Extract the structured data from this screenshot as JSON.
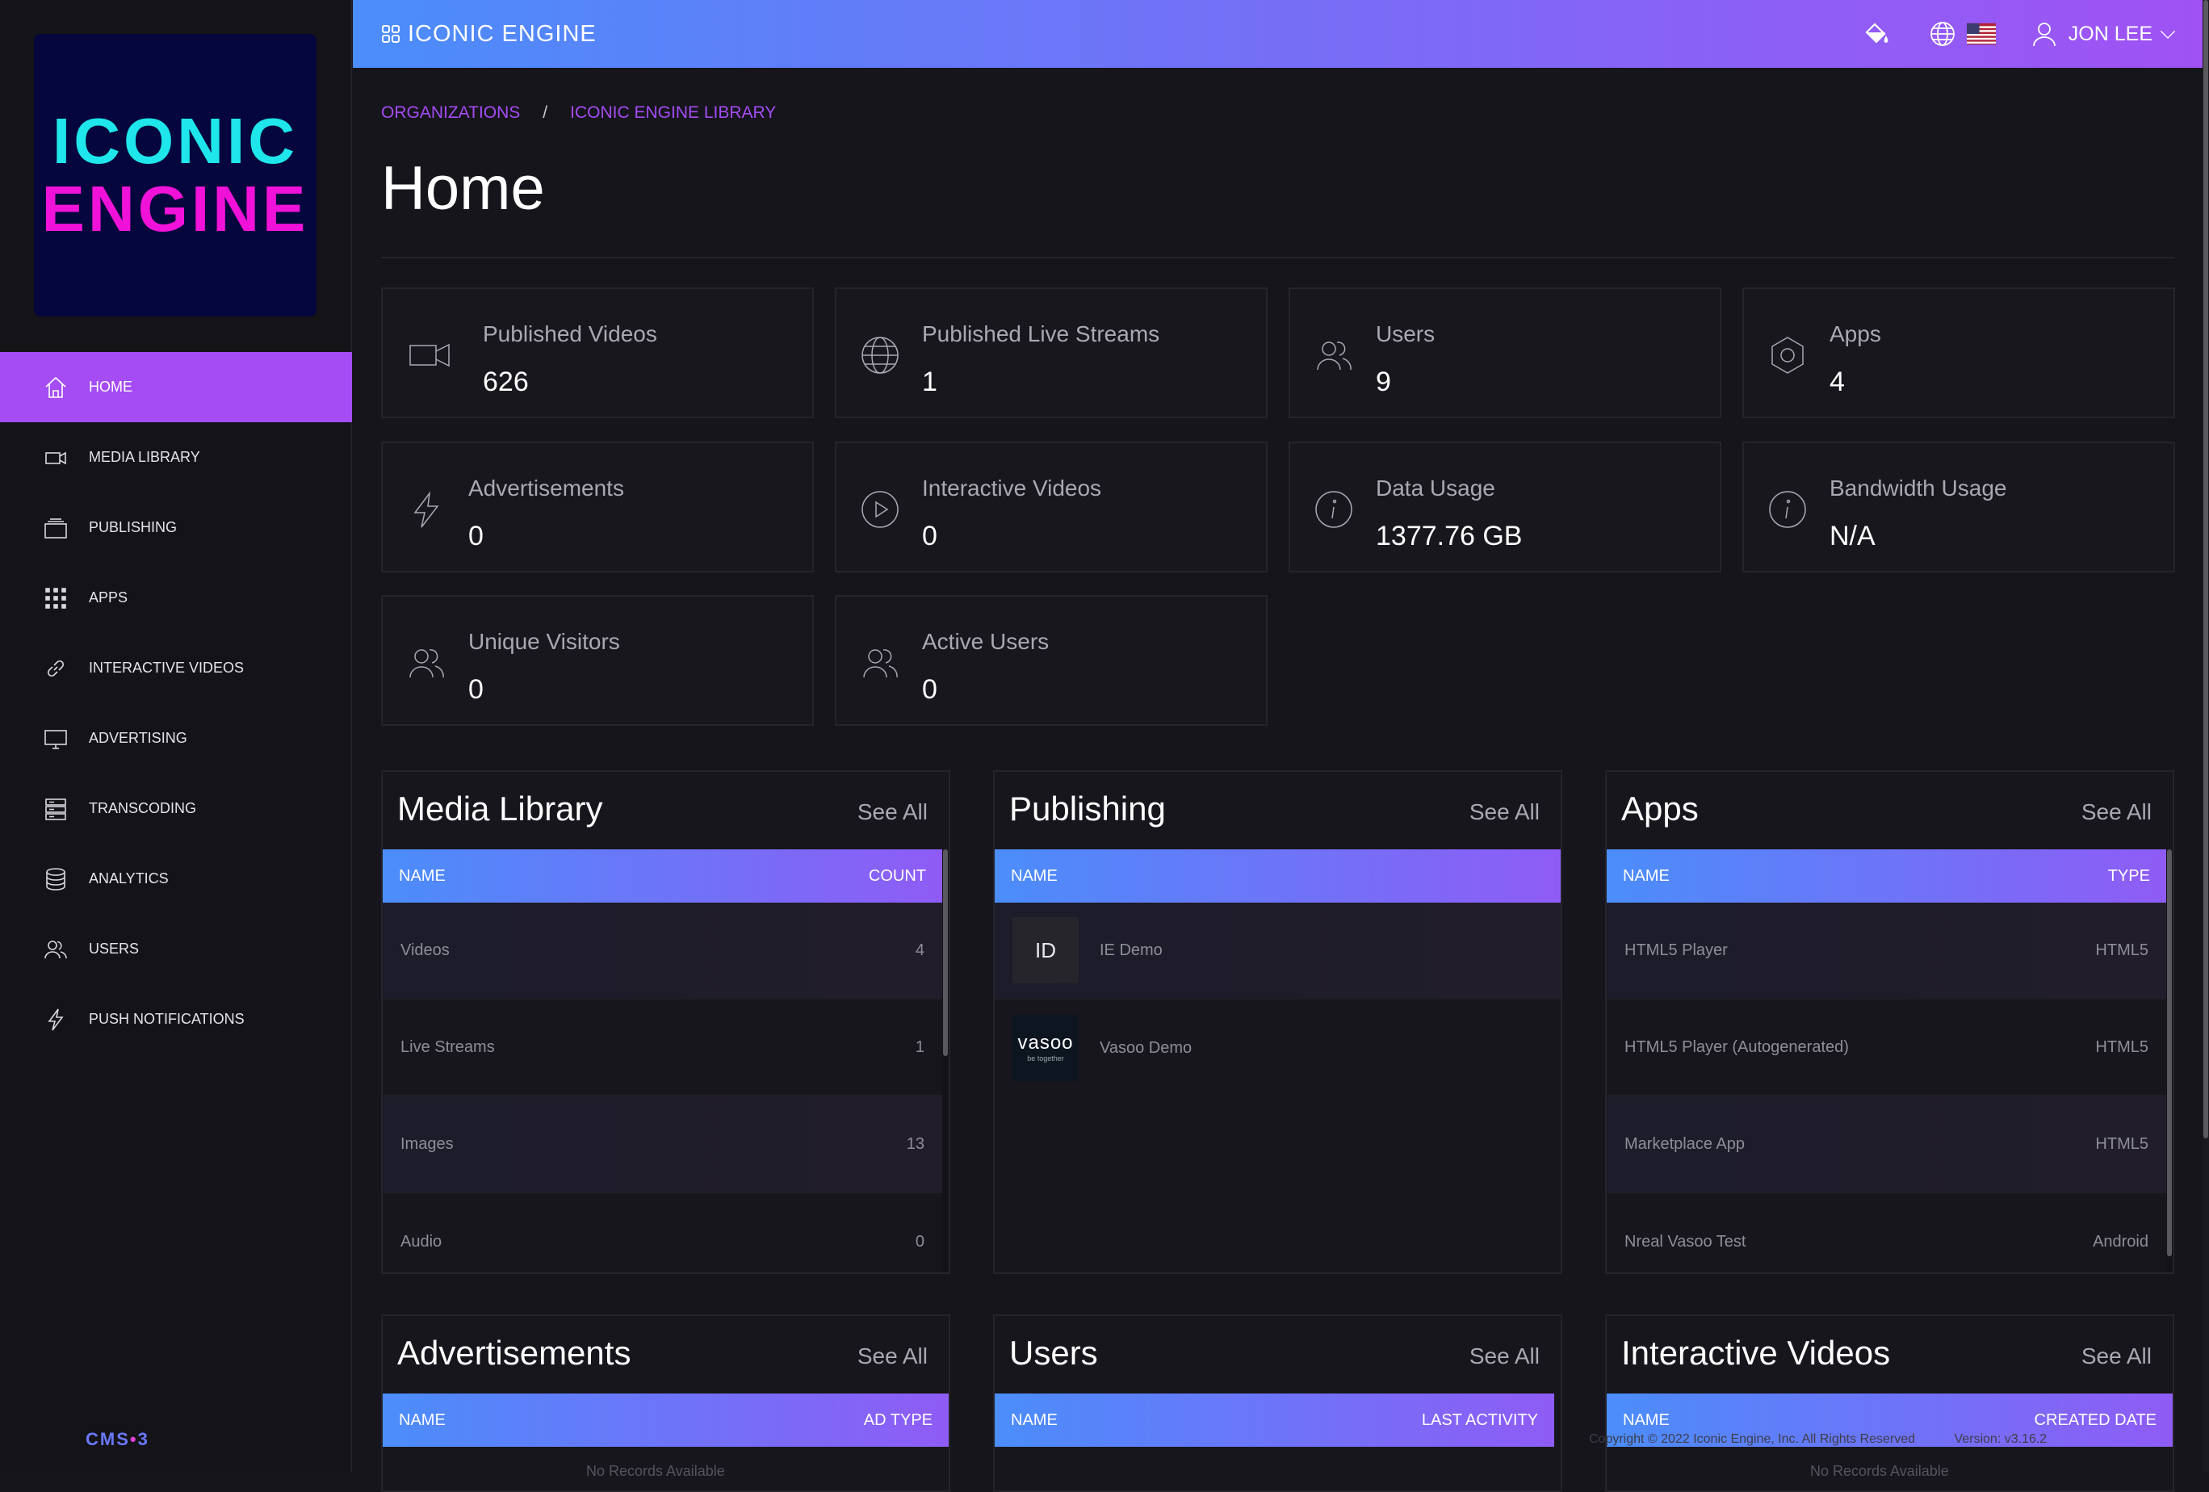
{
  "brand": {
    "logo_line1": "ICONIC",
    "logo_line2": "ENGINE",
    "top_title": "ICONIC ENGINE",
    "cms_logo_a": "CMS",
    "cms_logo_dot": "•",
    "cms_logo_b": "3"
  },
  "colors": {
    "accent": "#a54cf5",
    "gradient_start": "#4b8dfb",
    "gradient_end": "#a052f4",
    "logo_cyan": "#1ee6ea",
    "logo_magenta": "#f112d9"
  },
  "sidebar": {
    "items": [
      {
        "label": "HOME",
        "icon": "home-icon",
        "active": true
      },
      {
        "label": "MEDIA LIBRARY",
        "icon": "video-camera-icon"
      },
      {
        "label": "PUBLISHING",
        "icon": "layers-icon"
      },
      {
        "label": "APPS",
        "icon": "grid-icon"
      },
      {
        "label": "INTERACTIVE VIDEOS",
        "icon": "link-icon"
      },
      {
        "label": "ADVERTISING",
        "icon": "monitor-icon"
      },
      {
        "label": "TRANSCODING",
        "icon": "server-icon"
      },
      {
        "label": "ANALYTICS",
        "icon": "database-icon"
      },
      {
        "label": "USERS",
        "icon": "users-icon"
      },
      {
        "label": "PUSH NOTIFICATIONS",
        "icon": "lightning-icon"
      }
    ]
  },
  "topbar": {
    "user_name": "JON LEE",
    "icons": [
      "paint-bucket-icon",
      "globe-icon",
      "us-flag-icon",
      "user-icon",
      "chevron-down-icon"
    ]
  },
  "breadcrumb": {
    "items": [
      "ORGANIZATIONS",
      "ICONIC ENGINE LIBRARY"
    ],
    "separator": "/"
  },
  "page_title": "Home",
  "stats": [
    {
      "label": "Published Videos",
      "value": "626",
      "icon": "video-camera-icon"
    },
    {
      "label": "Published Live Streams",
      "value": "1",
      "icon": "globe-icon"
    },
    {
      "label": "Users",
      "value": "9",
      "icon": "users-icon"
    },
    {
      "label": "Apps",
      "value": "4",
      "icon": "hexagon-icon"
    },
    {
      "label": "Advertisements",
      "value": "0",
      "icon": "lightning-icon"
    },
    {
      "label": "Interactive Videos",
      "value": "0",
      "icon": "play-circle-icon"
    },
    {
      "label": "Data Usage",
      "value": "1377.76 GB",
      "icon": "info-icon"
    },
    {
      "label": "Bandwidth Usage",
      "value": "N/A",
      "icon": "info-icon"
    },
    {
      "label": "Unique Visitors",
      "value": "0",
      "icon": "users-icon"
    },
    {
      "label": "Active Users",
      "value": "0",
      "icon": "users-icon"
    }
  ],
  "see_all_label": "See All",
  "panels": {
    "media_library": {
      "title": "Media Library",
      "col_name": "NAME",
      "col_value": "COUNT",
      "rows": [
        {
          "name": "Videos",
          "value": "4"
        },
        {
          "name": "Live Streams",
          "value": "1"
        },
        {
          "name": "Images",
          "value": "13"
        },
        {
          "name": "Audio",
          "value": "0"
        }
      ]
    },
    "publishing": {
      "title": "Publishing",
      "col_name": "NAME",
      "rows": [
        {
          "thumb": "ID",
          "name": "IE Demo"
        },
        {
          "thumb_word": "vasoo",
          "thumb_sub": "be together",
          "name": "Vasoo Demo"
        }
      ]
    },
    "apps": {
      "title": "Apps",
      "col_name": "NAME",
      "col_value": "TYPE",
      "rows": [
        {
          "name": "HTML5 Player",
          "value": "HTML5"
        },
        {
          "name": "HTML5 Player (Autogenerated)",
          "value": "HTML5"
        },
        {
          "name": "Marketplace App",
          "value": "HTML5"
        },
        {
          "name": "Nreal Vasoo Test",
          "value": "Android"
        }
      ]
    },
    "advertisements": {
      "title": "Advertisements",
      "col_name": "NAME",
      "col_value": "AD TYPE"
    },
    "users": {
      "title": "Users",
      "col_name": "NAME",
      "col_value": "LAST ACTIVITY"
    },
    "interactive_videos": {
      "title": "Interactive Videos",
      "col_name": "NAME",
      "col_value": "CREATED DATE"
    }
  },
  "footer": {
    "copyright": "Copyright © 2022 Iconic Engine, Inc. All Rights Reserved",
    "version": "Version: v3.16.2",
    "no_records_partial": "No Records Available"
  }
}
